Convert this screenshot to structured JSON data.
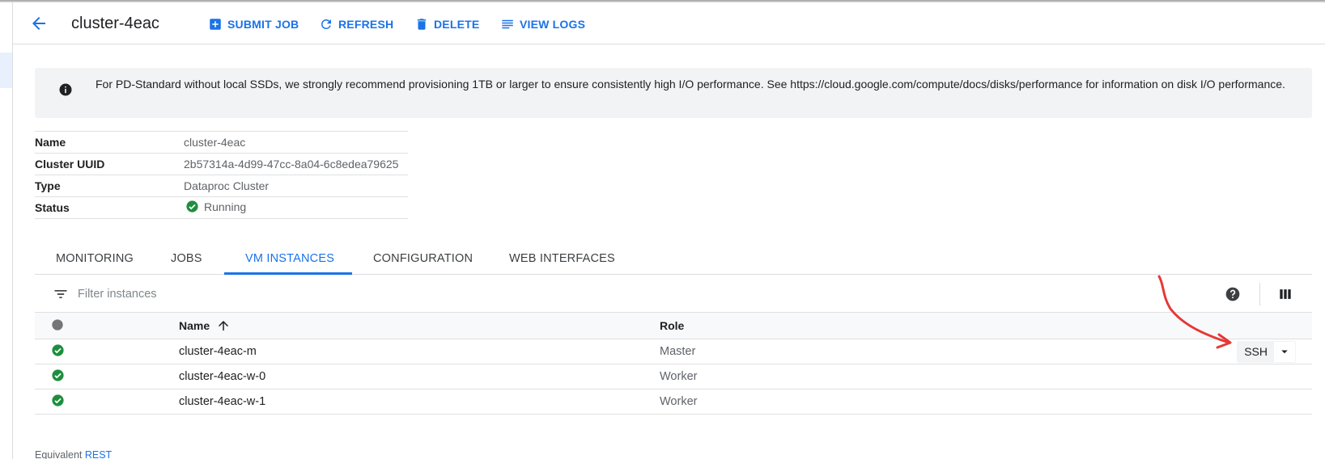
{
  "header": {
    "title": "cluster-4eac",
    "actions": [
      {
        "label": "SUBMIT JOB",
        "icon": "add-box-icon"
      },
      {
        "label": "REFRESH",
        "icon": "refresh-icon"
      },
      {
        "label": "DELETE",
        "icon": "trash-icon"
      },
      {
        "label": "VIEW LOGS",
        "icon": "logs-icon"
      }
    ]
  },
  "banner": {
    "icon": "info-icon",
    "message": "For PD-Standard without local SSDs, we strongly recommend provisioning 1TB or larger to ensure consistently high I/O performance. See https://cloud.google.com/compute/docs/disks/performance for information on disk I/O performance."
  },
  "details": [
    {
      "label": "Name",
      "value": "cluster-4eac"
    },
    {
      "label": "Cluster UUID",
      "value": "2b57314a-4d99-47cc-8a04-6c8edea79625"
    },
    {
      "label": "Type",
      "value": "Dataproc Cluster"
    },
    {
      "label": "Status",
      "value": "Running"
    }
  ],
  "tabs": [
    {
      "label": "MONITORING",
      "active": false
    },
    {
      "label": "JOBS",
      "active": false
    },
    {
      "label": "VM INSTANCES",
      "active": true
    },
    {
      "label": "CONFIGURATION",
      "active": false
    },
    {
      "label": "WEB INTERFACES",
      "active": false
    }
  ],
  "filter": {
    "placeholder": "Filter instances"
  },
  "table": {
    "columns": [
      "Name",
      "Role"
    ],
    "sort": {
      "column": "Name",
      "direction": "ascending"
    },
    "rows": [
      {
        "name": "cluster-4eac-m",
        "role": "Master",
        "status": "ok"
      },
      {
        "name": "cluster-4eac-w-0",
        "role": "Worker",
        "status": "ok"
      },
      {
        "name": "cluster-4eac-w-1",
        "role": "Worker",
        "status": "ok"
      }
    ],
    "ssh_label": "SSH"
  },
  "footer": {
    "prefix": "Equivalent",
    "link": "REST"
  },
  "colors": {
    "accent": "#1a73e8",
    "ok": "#1e8e3e",
    "annotation": "#e53935"
  }
}
